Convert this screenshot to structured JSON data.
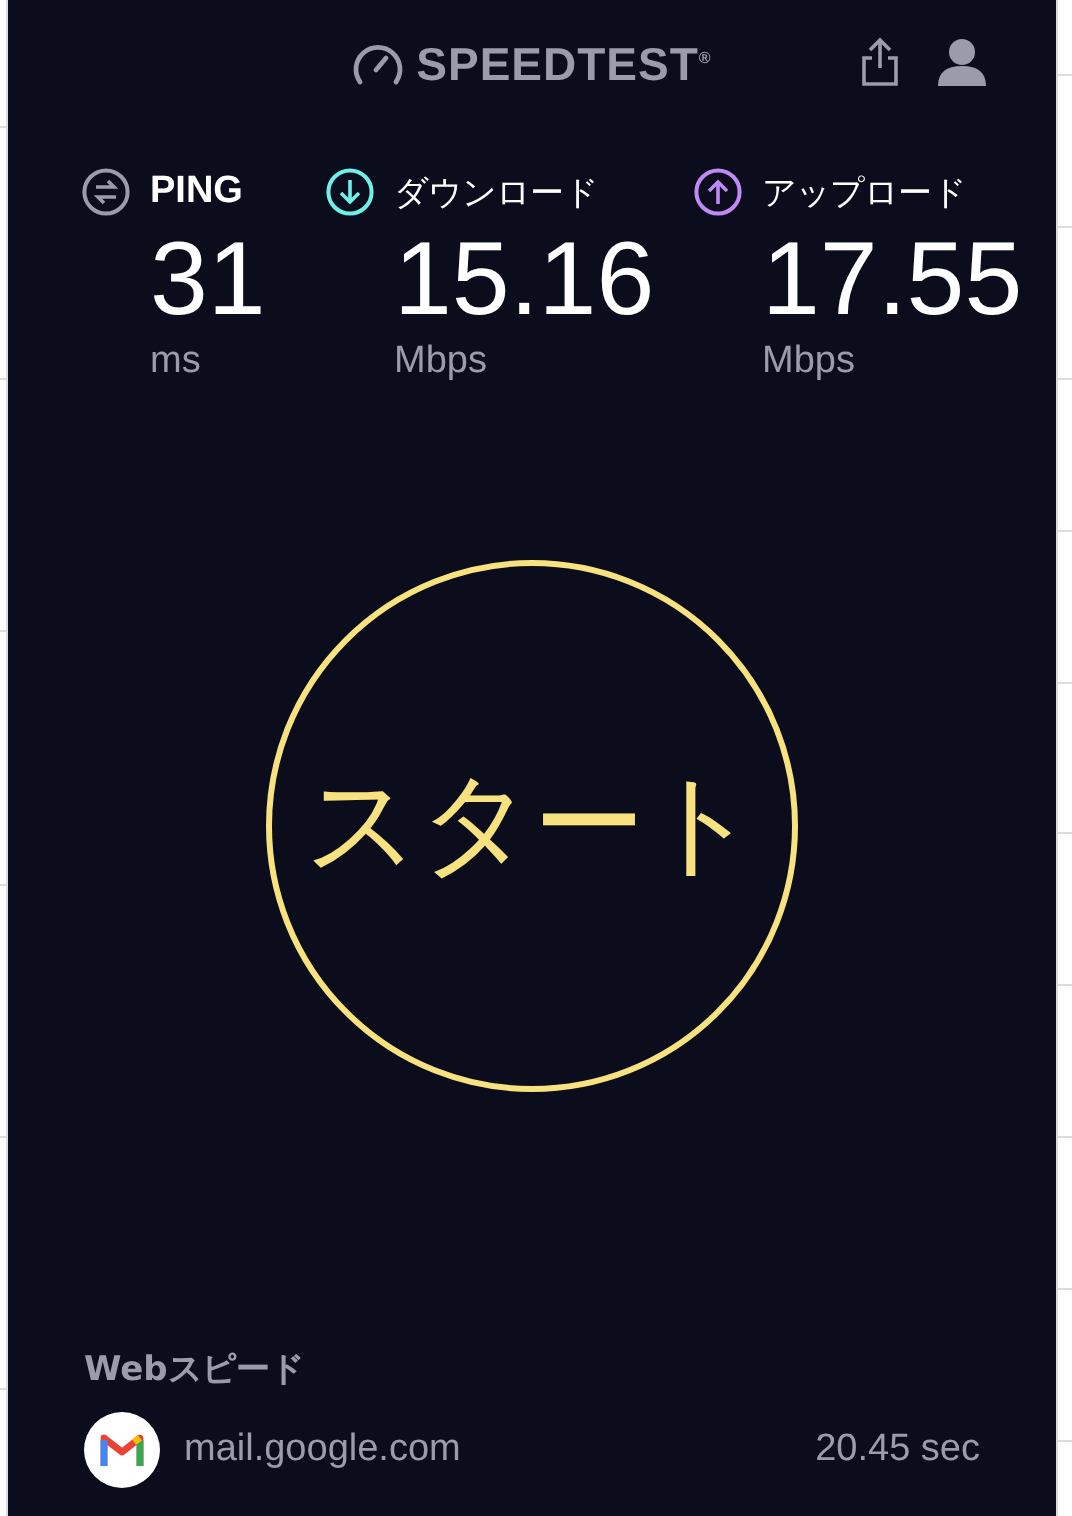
{
  "header": {
    "logo": "SPEEDTEST$^{®}$"
  },
  "metrics": [
    {
      "kind": "ping",
      "label": "PING",
      "value": "31",
      "unit": "ms",
      "color": "#9a9cab"
    },
    {
      "kind": "download",
      "label": "ダウンロード",
      "value": "15.16",
      "unit": "Mbps",
      "color": "#6ff0e6"
    },
    {
      "kind": "upload",
      "label": "アップロード",
      "value": "17.55",
      "unit": "Mbps",
      "color": "#c08af5"
    }
  ],
  "start_button": "スタート",
  "web_speed": {
    "title": "Webスピード",
    "site": "mail.google.com",
    "time": "20.45 sec"
  }
}
